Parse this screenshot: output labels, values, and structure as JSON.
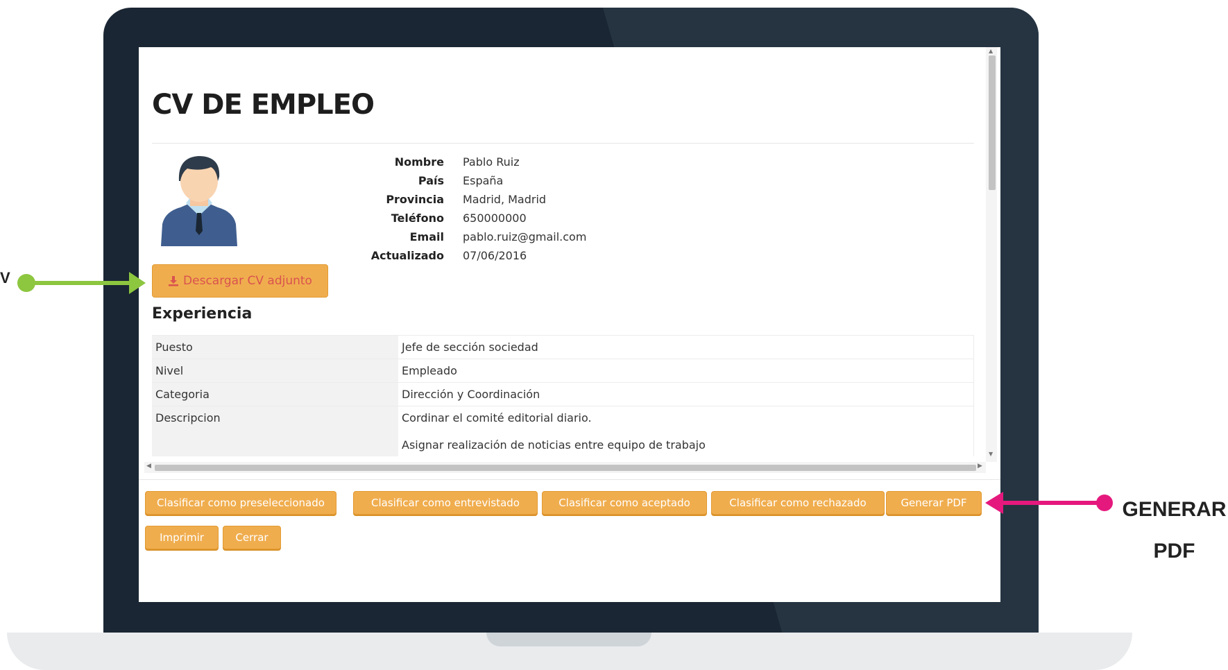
{
  "page": {
    "title": "CV DE EMPLEO"
  },
  "candidate": {
    "fields": [
      {
        "label": "Nombre",
        "value": "Pablo Ruiz"
      },
      {
        "label": "País",
        "value": "España"
      },
      {
        "label": "Provincia",
        "value": "Madrid, Madrid"
      },
      {
        "label": "Teléfono",
        "value": "650000000"
      },
      {
        "label": "Email",
        "value": "pablo.ruiz@gmail.com"
      },
      {
        "label": "Actualizado",
        "value": "07/06/2016"
      }
    ],
    "download_label": "Descargar CV adjunto"
  },
  "experience": {
    "heading": "Experiencia",
    "rows": [
      {
        "key": "Puesto",
        "value": "Jefe de sección sociedad"
      },
      {
        "key": "Nivel",
        "value": "Empleado"
      },
      {
        "key": "Categoria",
        "value": "Dirección y Coordinación"
      },
      {
        "key": "Descripcion",
        "value": "Cordinar el comité editorial diario.",
        "value2": "Asignar realización de noticias entre equipo de trabajo"
      }
    ]
  },
  "actions": {
    "preselect": "Clasificar como preseleccionado",
    "interviewed": "Clasificar como entrevistado",
    "accepted": "Clasificar como aceptado",
    "rejected": "Clasificar como rechazado",
    "pdf": "Generar PDF",
    "print": "Imprimir",
    "close": "Cerrar"
  },
  "callouts": {
    "left": "V",
    "right_line1": "GENERAR",
    "right_line2": "PDF"
  },
  "colors": {
    "accent": "#f0ad4e",
    "download_text": "#d9534f",
    "arrow_green": "#8dc63f",
    "arrow_pink": "#e5197d",
    "bezel": "#1a2633"
  }
}
